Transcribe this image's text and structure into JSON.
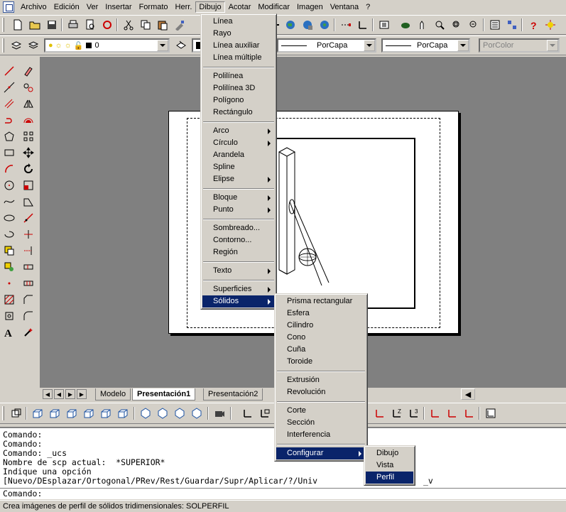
{
  "menubar": {
    "items": [
      "Archivo",
      "Edición",
      "Ver",
      "Insertar",
      "Formato",
      "Herr.",
      "Dibujo",
      "Acotar",
      "Modificar",
      "Imagen",
      "Ventana",
      "?"
    ],
    "active_index": 6
  },
  "properties": {
    "layer_value": "0",
    "linetype_value": "PorCapa",
    "lineweight_value": "PorCapa",
    "plotstyle_value": "PorColor"
  },
  "dibujo_menu": {
    "groups": [
      [
        {
          "label": "Línea"
        },
        {
          "label": "Rayo"
        },
        {
          "label": "Línea auxiliar"
        },
        {
          "label": "Línea múltiple"
        }
      ],
      [
        {
          "label": "Polilínea"
        },
        {
          "label": "Polilínea 3D"
        },
        {
          "label": "Polígono"
        },
        {
          "label": "Rectángulo"
        }
      ],
      [
        {
          "label": "Arco",
          "submenu": true
        },
        {
          "label": "Círculo",
          "submenu": true
        },
        {
          "label": "Arandela"
        },
        {
          "label": "Spline"
        },
        {
          "label": "Elipse",
          "submenu": true
        }
      ],
      [
        {
          "label": "Bloque",
          "submenu": true
        },
        {
          "label": "Punto",
          "submenu": true
        }
      ],
      [
        {
          "label": "Sombreado..."
        },
        {
          "label": "Contorno..."
        },
        {
          "label": "Región"
        }
      ],
      [
        {
          "label": "Texto",
          "submenu": true
        }
      ],
      [
        {
          "label": "Superficies",
          "submenu": true
        },
        {
          "label": "Sólidos",
          "submenu": true,
          "selected": true
        }
      ]
    ]
  },
  "solidos_menu": {
    "groups": [
      [
        {
          "label": "Prisma rectangular"
        },
        {
          "label": "Esfera"
        },
        {
          "label": "Cilindro"
        },
        {
          "label": "Cono"
        },
        {
          "label": "Cuña"
        },
        {
          "label": "Toroide"
        }
      ],
      [
        {
          "label": "Extrusión"
        },
        {
          "label": "Revolución"
        }
      ],
      [
        {
          "label": "Corte"
        },
        {
          "label": "Sección"
        },
        {
          "label": "Interferencia"
        }
      ],
      [
        {
          "label": "Configurar",
          "submenu": true,
          "selected": true
        }
      ]
    ]
  },
  "configurar_menu": {
    "groups": [
      [
        {
          "label": "Dibujo"
        },
        {
          "label": "Vista"
        },
        {
          "label": "Perfil",
          "selected": true
        }
      ]
    ]
  },
  "layout_tabs": {
    "tabs": [
      "Modelo",
      "Presentación1",
      "Presentación2"
    ],
    "active_index": 1
  },
  "command_window": {
    "lines": [
      "Comando:",
      "Comando:",
      "Comando: _ucs",
      "Nombre de scp actual:  *SUPERIOR*",
      "Indique una opción",
      "[Nuevo/DEsplazar/Ortogonal/PRev/Rest/Guardar/Supr/Aplicar/?/Univ",
      "_v"
    ],
    "prompt": "Comando:"
  },
  "status_text": "Crea imágenes de perfil de sólidos tridimensionales: SOLPERFIL",
  "colors": {
    "face": "#d4d0c8",
    "highlight": "#0a246a",
    "canvas": "#808080"
  }
}
